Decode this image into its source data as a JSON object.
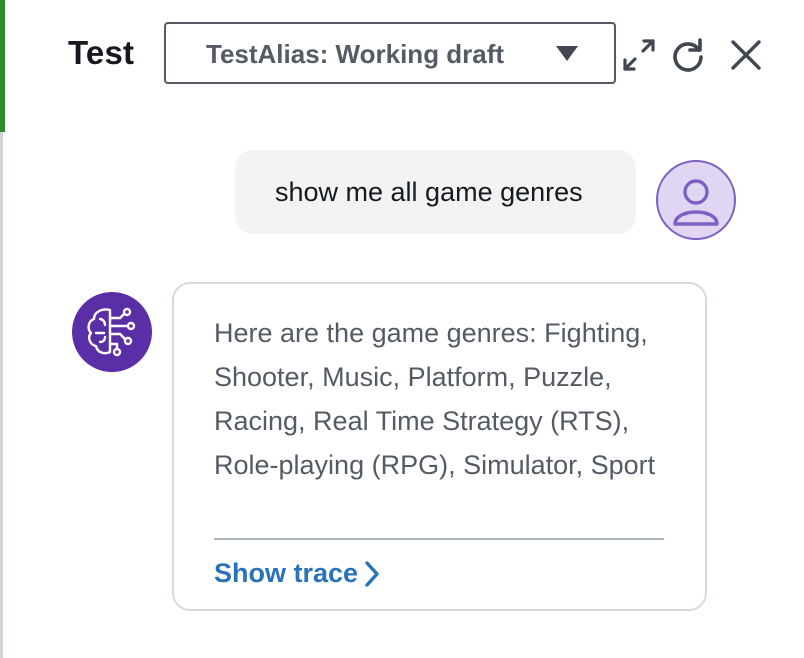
{
  "header": {
    "title": "Test",
    "alias_select": {
      "selected": "TestAlias: Working draft"
    },
    "icons": {
      "expand": "expand-icon",
      "refresh": "refresh-icon",
      "close": "close-icon"
    }
  },
  "conversation": {
    "user_message": {
      "text": "show me all game genres",
      "avatar_icon": "user-icon"
    },
    "bot_message": {
      "text": "Here are the game genres: Fighting, Shooter, Music, Platform, Puzzle, Racing, Real Time Strategy (RTS), Role-playing (RPG), Simulator, Sport",
      "avatar_icon": "ai-brain-icon",
      "show_trace_label": "Show trace"
    }
  },
  "colors": {
    "accent_green": "#2e8b2e",
    "link_blue": "#2a73b8",
    "bot_avatar_bg": "#5a2ea6",
    "user_avatar_bg": "#ded6f2",
    "user_bubble_bg": "#f2f3f3"
  }
}
